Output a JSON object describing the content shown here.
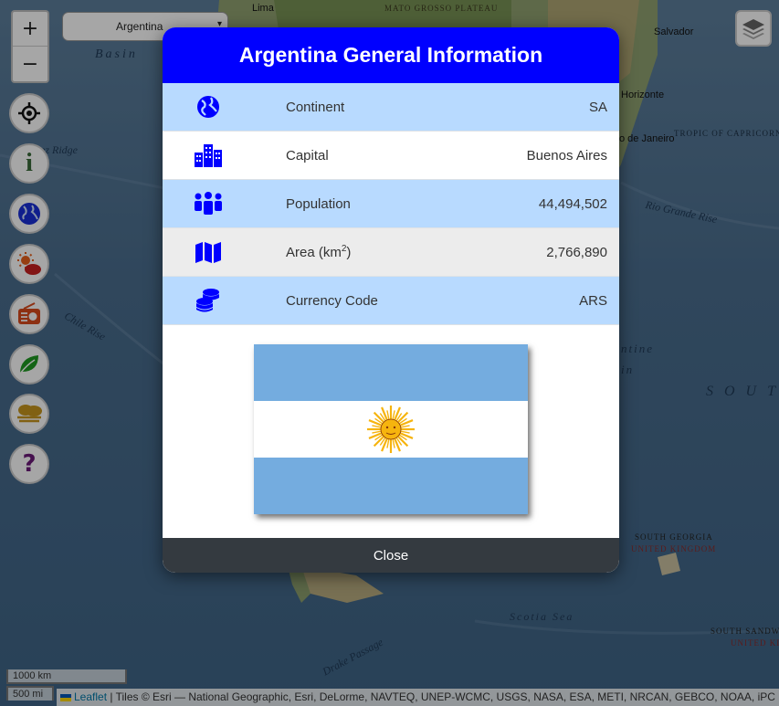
{
  "map": {
    "labels": {
      "lima": "Lima",
      "mato_grosso": "MATO GROSSO PLATEAU",
      "salvador": "Salvador",
      "basin": "Basin",
      "horizonte": "Horizonte",
      "rio_de_janeiro": "o de Janeiro",
      "tropic": "TROPIC OF CAPRICORN",
      "nazca_ridge": "ez Ridge",
      "rio_grande_rise": "Rio Grande Rise",
      "chile_rise": "Chile Rise",
      "argentine_basin_1": "ntine",
      "argentine_basin_2": "in",
      "south_atlantic": "S O U T",
      "south_georgia": "SOUTH GEORGIA",
      "united_kingdom_1": "UNITED KINGDOM",
      "scotia_sea": "Scotia   Sea",
      "drake_passage": "Drake Passage",
      "south_sandwich": "SOUTH SANDWI",
      "united_kingdom_2": "UNITED KIN"
    },
    "controls": {
      "zoom_in": "+",
      "zoom_out": "−",
      "selected_country": "Argentina",
      "caret": "▾"
    },
    "scale": {
      "km": "1000 km",
      "mi": "500 mi"
    },
    "attribution": {
      "leaflet": "Leaflet",
      "text": " | Tiles © Esri — National Geographic, Esri, DeLorme, NAVTEQ, UNEP-WCMC, USGS, NASA, ESA, METI, NRCAN, GEBCO, NOAA, iPC"
    },
    "buttons": [
      "locate-icon",
      "info-icon",
      "globe-icon",
      "weather-icon",
      "radio-icon",
      "leaf-icon",
      "cloud-fog-icon",
      "question-icon"
    ]
  },
  "modal": {
    "title": "Argentina General Information",
    "rows": [
      {
        "icon": "globe-icon",
        "label": "Continent",
        "value": "SA"
      },
      {
        "icon": "city-icon",
        "label": "Capital",
        "value": "Buenos Aires"
      },
      {
        "icon": "people-icon",
        "label": "Population",
        "value": "44,494,502"
      },
      {
        "icon": "map-icon",
        "label": "Area (km",
        "label_sup": "2",
        "label_end": ")",
        "value": "2,766,890"
      },
      {
        "icon": "coins-icon",
        "label": "Currency Code",
        "value": "ARS"
      }
    ],
    "close_label": "Close"
  },
  "colors": {
    "header_blue": "#0000ff",
    "row_blue": "#b8daff",
    "row_grey": "#ececec",
    "icon_blue": "#0000ff",
    "close_bg": "#343a40",
    "flag_blue": "#74acdf",
    "flag_sun": "#f6b40e"
  }
}
